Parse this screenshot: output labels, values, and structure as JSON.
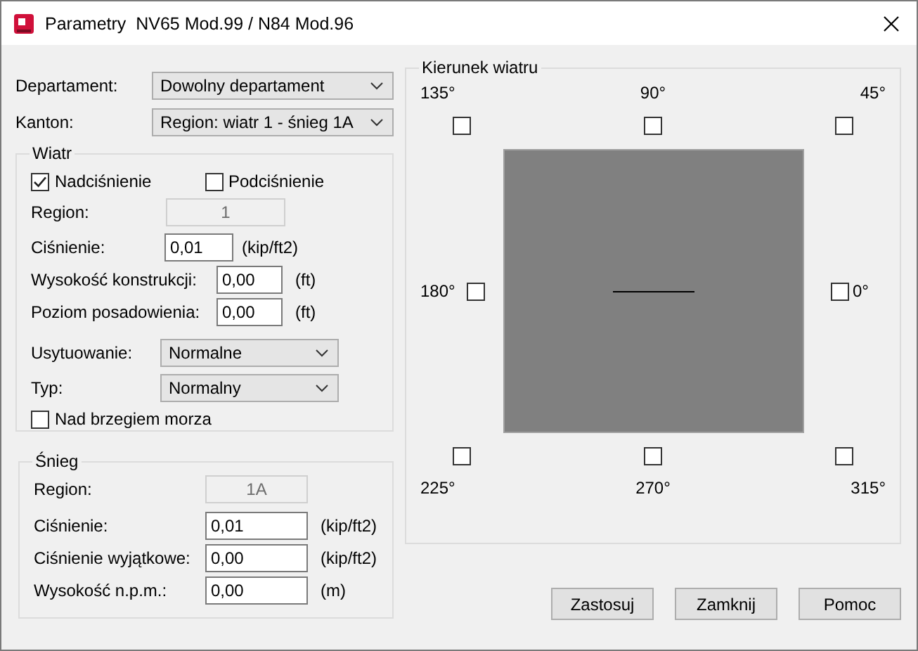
{
  "window": {
    "title": "Parametry  NV65 Mod.99 / N84 Mod.96"
  },
  "departament": {
    "label": "Departament:",
    "value": "Dowolny departament"
  },
  "kanton": {
    "label": "Kanton:",
    "value": "Region: wiatr 1 - śnieg 1A"
  },
  "wind": {
    "title": "Wiatr",
    "pressure_options": [
      {
        "label": "Nadciśnienie",
        "checked": true
      },
      {
        "label": "Podciśnienie",
        "checked": false
      }
    ],
    "fields": [
      {
        "label": "Region:",
        "value": "1",
        "disabled": true
      },
      {
        "label": "Ciśnienie:",
        "value": "0,01",
        "unit": "(kip/ft2)",
        "disabled": false
      },
      {
        "label": "Wysokość konstrukcji:",
        "value": "0,00",
        "unit": "(ft)",
        "disabled": false
      },
      {
        "label": "Poziom posadowienia:",
        "value": "0,00",
        "unit": "(ft)",
        "disabled": false
      }
    ],
    "combos": [
      {
        "label": "Usytuowanie:",
        "value": "Normalne"
      },
      {
        "label": "Typ:",
        "value": "Normalny"
      }
    ],
    "seaside": {
      "label": "Nad brzegiem morza",
      "checked": false
    }
  },
  "snow": {
    "title": "Śnieg",
    "fields": [
      {
        "label": "Region:",
        "value": "1A",
        "disabled": true
      },
      {
        "label": "Ciśnienie:",
        "value": "0,01",
        "unit": "(kip/ft2)",
        "disabled": false
      },
      {
        "label": "Ciśnienie wyjątkowe:",
        "value": "0,00",
        "unit": "(kip/ft2)",
        "disabled": false
      },
      {
        "label": "Wysokość n.p.m.:",
        "value": "0,00",
        "unit": "(m)",
        "disabled": false
      }
    ]
  },
  "direction": {
    "title": "Kierunek wiatru",
    "options": [
      {
        "label": "135°",
        "checked": false
      },
      {
        "label": "90°",
        "checked": false
      },
      {
        "label": "45°",
        "checked": false
      },
      {
        "label": "180°",
        "checked": false
      },
      {
        "label": "0°",
        "checked": false
      },
      {
        "label": "225°",
        "checked": false
      },
      {
        "label": "270°",
        "checked": false
      },
      {
        "label": "315°",
        "checked": false
      }
    ]
  },
  "buttons": [
    "Zastosuj",
    "Zamknij",
    "Pomoc"
  ]
}
